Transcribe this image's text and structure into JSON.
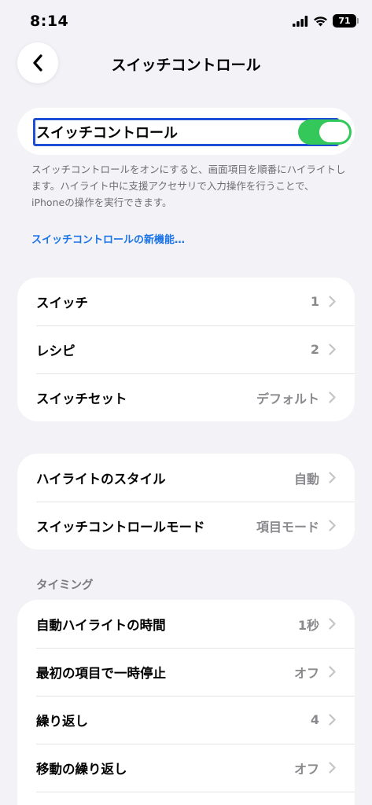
{
  "status_bar": {
    "time": "8:14",
    "battery": "71",
    "icons": [
      "signal-icon",
      "wifi-icon",
      "battery-icon"
    ]
  },
  "nav": {
    "back_icon": "chevron-left-icon",
    "title": "スイッチコントロール"
  },
  "main_toggle": {
    "label": "スイッチコントロール",
    "state": "on",
    "on_color": "#34c759",
    "focus_color": "#1f4fd6"
  },
  "description": "スイッチコントロールをオンにすると、画面項目を順番にハイライトします。ハイライト中に支援アクセサリで入力操作を行うことで、iPhoneの操作を実行できます。",
  "new_features_link": "スイッチコントロールの新機能…",
  "group1": [
    {
      "label": "スイッチ",
      "value": "1"
    },
    {
      "label": "レシピ",
      "value": "2"
    },
    {
      "label": "スイッチセット",
      "value": "デフォルト"
    }
  ],
  "group2": [
    {
      "label": "ハイライトのスタイル",
      "value": "自動"
    },
    {
      "label": "スイッチコントロールモード",
      "value": "項目モード"
    }
  ],
  "timing_header": "タイミング",
  "group3": [
    {
      "label": "自動ハイライトの時間",
      "value": "1秒"
    },
    {
      "label": "最初の項目で一時停止",
      "value": "オフ"
    },
    {
      "label": "繰り返し",
      "value": "4"
    },
    {
      "label": "移動の繰り返し",
      "value": "オフ"
    }
  ],
  "colors": {
    "background": "#f2f2f7",
    "link": "#1a73e8",
    "secondary_text": "#8a8a8e"
  }
}
